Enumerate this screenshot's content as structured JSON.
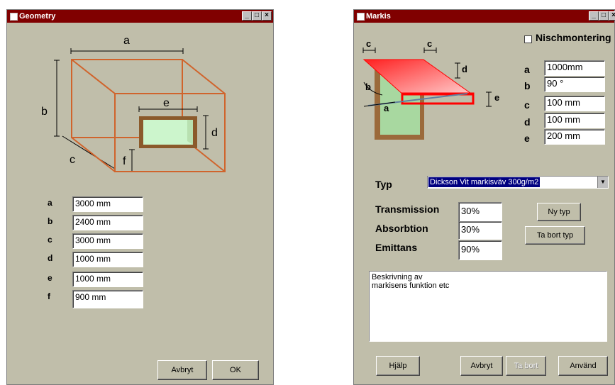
{
  "geometry": {
    "title": "Geometry",
    "diagram_labels": {
      "a": "a",
      "b": "b",
      "c": "c",
      "d": "d",
      "e": "e",
      "f": "f"
    },
    "fields": [
      {
        "label": "a",
        "value": "3000 mm"
      },
      {
        "label": "b",
        "value": "2400 mm"
      },
      {
        "label": "c",
        "value": "3000 mm"
      },
      {
        "label": "d",
        "value": "1000 mm"
      },
      {
        "label": "e",
        "value": "1000 mm"
      },
      {
        "label": "f",
        "value": "900  mm"
      }
    ],
    "cancel_label": "Avbryt",
    "ok_label": "OK"
  },
  "markis": {
    "title": "Markis",
    "niche_label": "Nischmontering",
    "diagram_labels": {
      "a": "a",
      "b": "b",
      "c": "c",
      "d": "d",
      "e": "e"
    },
    "fields": [
      {
        "label": "a",
        "value": "1000mm"
      },
      {
        "label": "b",
        "value": "90 °"
      },
      {
        "label": "c",
        "value": "100 mm"
      },
      {
        "label": "d",
        "value": "100 mm"
      },
      {
        "label": "e",
        "value": "200 mm"
      }
    ],
    "type_label": "Typ",
    "type_value": "Dickson Vit markisväv 300g/m2",
    "props": [
      {
        "label": "Transmission",
        "value": "30%"
      },
      {
        "label": "Absorbtion",
        "value": "30%"
      },
      {
        "label": "Emittans",
        "value": "90%"
      }
    ],
    "new_type_label": "Ny typ",
    "delete_type_label": "Ta bort typ",
    "description": "Beskrivning av\nmarkisens funktion etc",
    "help_label": "Hjälp",
    "cancel_label": "Avbryt",
    "delete_label": "Ta bort",
    "apply_label": "Använd"
  },
  "colors": {
    "titlebar": "#800000",
    "dialog_bg": "#c0beaa",
    "box_lines": "#d0642c",
    "window_frame": "#8b5a2b",
    "glass": "#ccf5cc",
    "awning_red": "#ff0000"
  }
}
